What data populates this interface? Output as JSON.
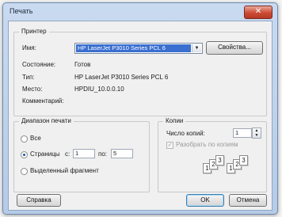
{
  "window": {
    "title": "Печать",
    "close_glyph": "✕"
  },
  "printer": {
    "group_title": "Принтер",
    "name_label": "Имя:",
    "name_value": "HP LaserJet P3010 Series PCL 6",
    "properties_button": "Свойства...",
    "status_label": "Состояние:",
    "status_value": "Готов",
    "type_label": "Тип:",
    "type_value": "HP LaserJet P3010 Series PCL 6",
    "location_label": "Место:",
    "location_value": "HPDIU_10.0.0.10",
    "comment_label": "Комментарий:",
    "comment_value": ""
  },
  "range": {
    "group_title": "Диапазон печати",
    "all_label": "Все",
    "pages_label": "Страницы",
    "from_label": "с:",
    "from_value": "1",
    "to_label": "по:",
    "to_value": "5",
    "selection_label": "Выделенный фрагмент",
    "selected_option": "pages"
  },
  "copies": {
    "group_title": "Копии",
    "count_label": "Число копий:",
    "count_value": "1",
    "collate_label": "Разобрать по копиям",
    "collate_checked": true,
    "collate_enabled": false,
    "sheet_digits": [
      "1",
      "2",
      "3"
    ]
  },
  "footer": {
    "help_button": "Справка",
    "ok_button": "OK",
    "cancel_button": "Отмена"
  },
  "icons": {
    "dropdown": "chevron-down-icon",
    "spin_up": "spin-up-icon",
    "spin_down": "spin-down-icon",
    "check": "checkmark-icon"
  },
  "colors": {
    "selection": "#3a6fd0",
    "close": "#cc4b34",
    "title_bar": "#c9daf0"
  }
}
